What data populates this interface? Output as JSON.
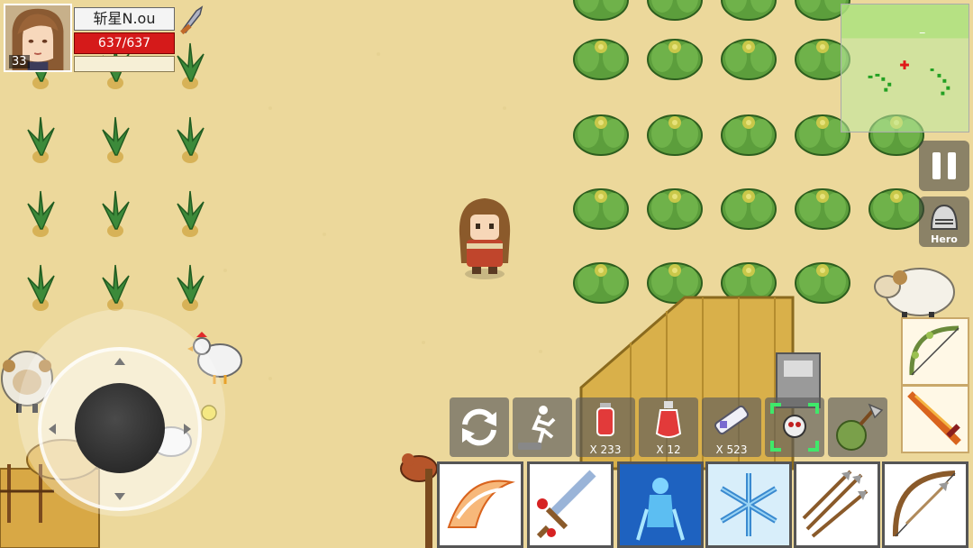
{
  "player": {
    "level": "33",
    "name": "斩星N.ou",
    "hp": "637/637"
  },
  "hero_button": {
    "label": "Hero"
  },
  "quick_slots": [
    {
      "id": "swap",
      "count": ""
    },
    {
      "id": "run",
      "count": ""
    },
    {
      "id": "red-potion",
      "count": "X 233"
    },
    {
      "id": "big-red-potion",
      "count": "X 12"
    },
    {
      "id": "scroll",
      "count": "X 523"
    },
    {
      "id": "target",
      "count": ""
    },
    {
      "id": "axe-bag",
      "count": ""
    }
  ],
  "skills": [
    {
      "name": "slash-wave-skill"
    },
    {
      "name": "bleeding-sword-skill"
    },
    {
      "name": "blue-spirit-skill"
    },
    {
      "name": "snowflake-skill"
    },
    {
      "name": "triple-arrow-skill"
    },
    {
      "name": "bow-skill"
    }
  ],
  "colors": {
    "sand": "#ecd89b",
    "hp_red": "#d51a1a",
    "minimap_marker": "#e01818",
    "target_green": "#3fe86a"
  }
}
